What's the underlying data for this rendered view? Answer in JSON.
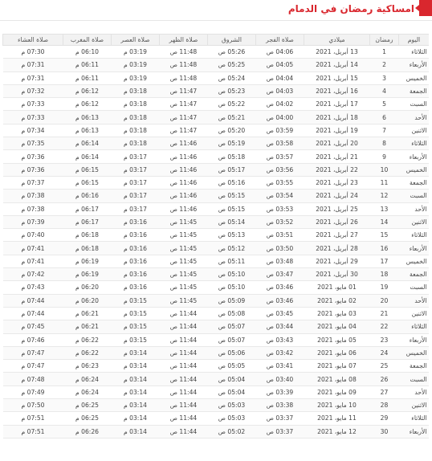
{
  "header": {
    "title": "امساكية رمضان في الدمام"
  },
  "table": {
    "columns": [
      "اليوم",
      "رمضان",
      "ميلادي",
      "صلاة الفجر",
      "الشروق",
      "صلاة الظهر",
      "صلاة العصر",
      "صلاة المغرب",
      "صلاة العشاء"
    ],
    "rows": [
      [
        "الثلاثاء",
        "1",
        "13 أبريل، 2021",
        "04:06 ص",
        "05:26 ص",
        "11:48 ص",
        "03:19 م",
        "06:10 م",
        "07:30 م"
      ],
      [
        "الأربعاء",
        "2",
        "14 أبريل، 2021",
        "04:05 ص",
        "05:25 ص",
        "11:48 ص",
        "03:19 م",
        "06:11 م",
        "07:31 م"
      ],
      [
        "الخميس",
        "3",
        "15 أبريل، 2021",
        "04:04 ص",
        "05:24 ص",
        "11:48 ص",
        "03:19 م",
        "06:11 م",
        "07:31 م"
      ],
      [
        "الجمعة",
        "4",
        "16 أبريل، 2021",
        "04:03 ص",
        "05:23 ص",
        "11:47 ص",
        "03:18 م",
        "06:12 م",
        "07:32 م"
      ],
      [
        "السبت",
        "5",
        "17 أبريل، 2021",
        "04:02 ص",
        "05:22 ص",
        "11:47 ص",
        "03:18 م",
        "06:12 م",
        "07:33 م"
      ],
      [
        "الأحد",
        "6",
        "18 أبريل، 2021",
        "04:00 ص",
        "05:21 ص",
        "11:47 ص",
        "03:18 م",
        "06:13 م",
        "07:33 م"
      ],
      [
        "الاثنين",
        "7",
        "19 أبريل، 2021",
        "03:59 ص",
        "05:20 ص",
        "11:47 ص",
        "03:18 م",
        "06:13 م",
        "07:34 م"
      ],
      [
        "الثلاثاء",
        "8",
        "20 أبريل، 2021",
        "03:58 ص",
        "05:19 ص",
        "11:46 ص",
        "03:18 م",
        "06:14 م",
        "07:35 م"
      ],
      [
        "الأربعاء",
        "9",
        "21 أبريل، 2021",
        "03:57 ص",
        "05:18 ص",
        "11:46 ص",
        "03:17 م",
        "06:14 م",
        "07:36 م"
      ],
      [
        "الخميس",
        "10",
        "22 أبريل، 2021",
        "03:56 ص",
        "05:17 ص",
        "11:46 ص",
        "03:17 م",
        "06:15 م",
        "07:36 م"
      ],
      [
        "الجمعة",
        "11",
        "23 أبريل، 2021",
        "03:55 ص",
        "05:16 ص",
        "11:46 ص",
        "03:17 م",
        "06:15 م",
        "07:37 م"
      ],
      [
        "السبت",
        "12",
        "24 أبريل، 2021",
        "03:54 ص",
        "05:15 ص",
        "11:46 ص",
        "03:17 م",
        "06:16 م",
        "07:38 م"
      ],
      [
        "الأحد",
        "13",
        "25 أبريل، 2021",
        "03:53 ص",
        "05:15 ص",
        "11:46 ص",
        "03:17 م",
        "06:17 م",
        "07:38 م"
      ],
      [
        "الاثنين",
        "14",
        "26 أبريل، 2021",
        "03:52 ص",
        "05:14 ص",
        "11:45 ص",
        "03:16 م",
        "06:17 م",
        "07:39 م"
      ],
      [
        "الثلاثاء",
        "15",
        "27 أبريل، 2021",
        "03:51 ص",
        "05:13 ص",
        "11:45 ص",
        "03:16 م",
        "06:18 م",
        "07:40 م"
      ],
      [
        "الأربعاء",
        "16",
        "28 أبريل، 2021",
        "03:50 ص",
        "05:12 ص",
        "11:45 ص",
        "03:16 م",
        "06:18 م",
        "07:41 م"
      ],
      [
        "الخميس",
        "17",
        "29 أبريل، 2021",
        "03:48 ص",
        "05:11 ص",
        "11:45 ص",
        "03:16 م",
        "06:19 م",
        "07:41 م"
      ],
      [
        "الجمعة",
        "18",
        "30 أبريل، 2021",
        "03:47 ص",
        "05:10 ص",
        "11:45 ص",
        "03:16 م",
        "06:19 م",
        "07:42 م"
      ],
      [
        "السبت",
        "19",
        "01 مايو، 2021",
        "03:46 ص",
        "05:10 ص",
        "11:45 ص",
        "03:16 م",
        "06:20 م",
        "07:43 م"
      ],
      [
        "الأحد",
        "20",
        "02 مايو، 2021",
        "03:46 ص",
        "05:09 ص",
        "11:45 ص",
        "03:15 م",
        "06:20 م",
        "07:44 م"
      ],
      [
        "الاثنين",
        "21",
        "03 مايو، 2021",
        "03:45 ص",
        "05:08 ص",
        "11:44 ص",
        "03:15 م",
        "06:21 م",
        "07:44 م"
      ],
      [
        "الثلاثاء",
        "22",
        "04 مايو، 2021",
        "03:44 ص",
        "05:07 ص",
        "11:44 ص",
        "03:15 م",
        "06:21 م",
        "07:45 م"
      ],
      [
        "الأربعاء",
        "23",
        "05 مايو، 2021",
        "03:43 ص",
        "05:07 ص",
        "11:44 ص",
        "03:15 م",
        "06:22 م",
        "07:46 م"
      ],
      [
        "الخميس",
        "24",
        "06 مايو، 2021",
        "03:42 ص",
        "05:06 ص",
        "11:44 ص",
        "03:14 م",
        "06:22 م",
        "07:47 م"
      ],
      [
        "الجمعة",
        "25",
        "07 مايو، 2021",
        "03:41 ص",
        "05:05 ص",
        "11:44 ص",
        "03:14 م",
        "06:23 م",
        "07:47 م"
      ],
      [
        "السبت",
        "26",
        "08 مايو، 2021",
        "03:40 ص",
        "05:04 ص",
        "11:44 ص",
        "03:14 م",
        "06:24 م",
        "07:48 م"
      ],
      [
        "الأحد",
        "27",
        "09 مايو، 2021",
        "03:39 ص",
        "05:04 ص",
        "11:44 ص",
        "03:14 م",
        "06:24 م",
        "07:49 م"
      ],
      [
        "الاثنين",
        "28",
        "10 مايو، 2021",
        "03:38 ص",
        "05:03 ص",
        "11:44 ص",
        "03:14 م",
        "06:25 م",
        "07:50 م"
      ],
      [
        "الثلاثاء",
        "29",
        "11 مايو، 2021",
        "03:37 ص",
        "05:03 ص",
        "11:44 ص",
        "03:14 م",
        "06:25 م",
        "07:51 م"
      ],
      [
        "الأربعاء",
        "30",
        "12 مايو، 2021",
        "03:37 ص",
        "05:02 ص",
        "11:44 ص",
        "03:14 م",
        "06:26 م",
        "07:51 م"
      ]
    ]
  }
}
